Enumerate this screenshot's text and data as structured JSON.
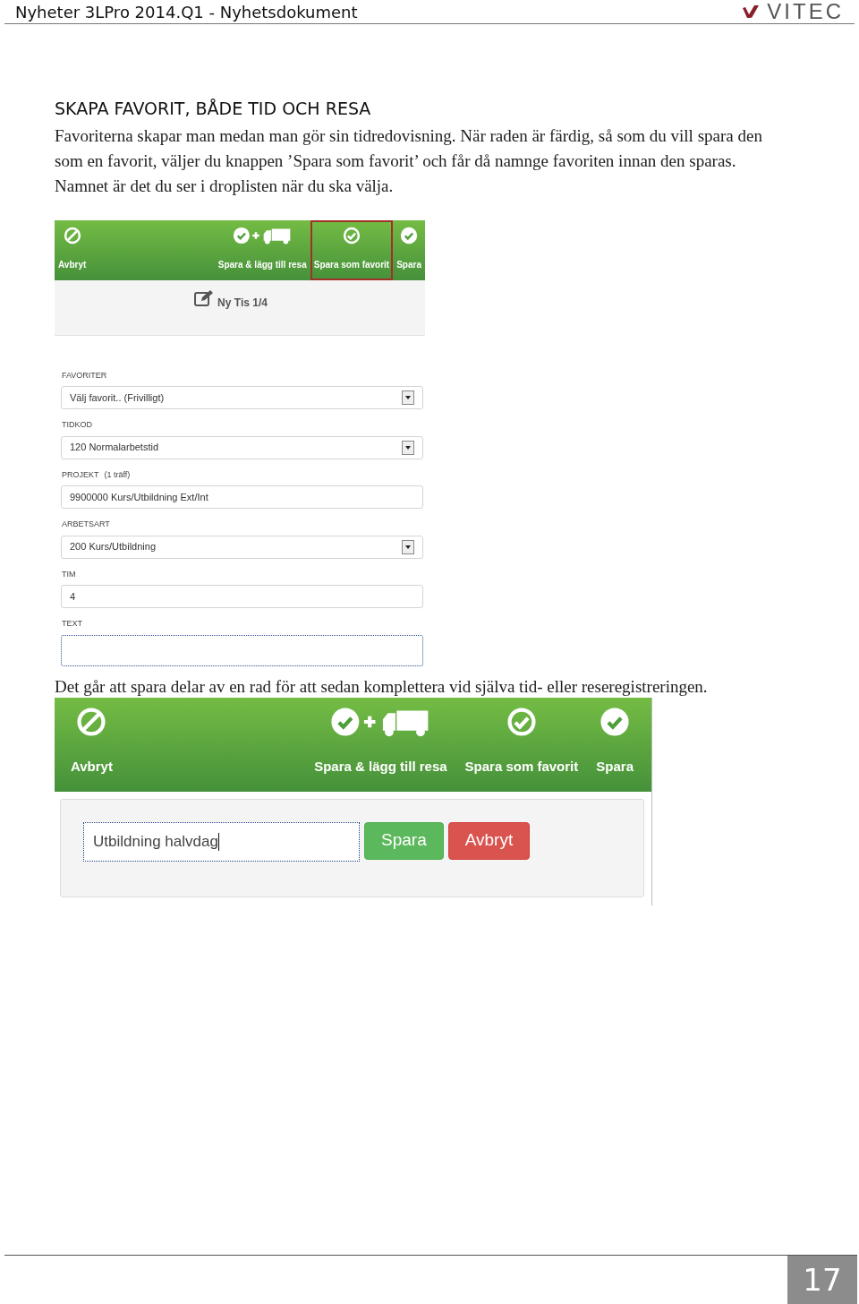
{
  "header": {
    "title": "Nyheter 3LPro 2014.Q1 - Nyhetsdokument",
    "logo_text": "VITEC"
  },
  "section_title": "SKAPA FAVORIT, BÅDE TID OCH RESA",
  "intro": "Favoriterna skapar man medan man gör sin tidredovisning. När raden är färdig, så som du vill spara den som en favorit, väljer du knappen ’Spara som favorit’ och får då namnge favoriten innan den sparas. Namnet är det du ser i droplisten när du ska välja.",
  "screenshot_1": {
    "toolbar": [
      {
        "kind": "cancel",
        "label": "Avbryt",
        "highlighted": false
      },
      {
        "kind": "save_trip",
        "label": "Spara & lägg till resa",
        "highlighted": false
      },
      {
        "kind": "save_favorite",
        "label": "Spara som favorit",
        "highlighted": true
      },
      {
        "kind": "save",
        "label": "Spara",
        "highlighted": false
      }
    ],
    "heading": "Ny Tis 1/4",
    "fields": [
      {
        "kind": "select",
        "label": "FAVORITER",
        "value": "Välj favorit.. (Frivilligt)",
        "focused": false
      },
      {
        "kind": "select",
        "label": "TIDKOD",
        "value": "120 Normalarbetstid",
        "focused": false
      },
      {
        "kind": "text",
        "label": "PROJEKT",
        "hint": "(1 träff)",
        "value": "9900000 Kurs/Utbildning Ext/Int",
        "focused": false
      },
      {
        "kind": "select",
        "label": "ARBETSART",
        "value": "200 Kurs/Utbildning",
        "focused": false
      },
      {
        "kind": "text",
        "label": "TIM",
        "value": "4",
        "focused": false
      },
      {
        "kind": "text",
        "label": "TEXT",
        "focused": true
      }
    ]
  },
  "note": "Det går att spara delar av en rad för att sedan komplettera vid själva tid- eller reseregistreringen.",
  "screenshot_2": {
    "toolbar": [
      {
        "kind": "cancel",
        "label": "Avbryt",
        "highlighted": false
      },
      {
        "kind": "save_trip",
        "label": "Spara & lägg till resa",
        "highlighted": false
      },
      {
        "kind": "save_favorite",
        "label": "Spara som favorit",
        "highlighted": false
      },
      {
        "kind": "save",
        "label": "Spara",
        "highlighted": false
      }
    ],
    "name_field": {
      "value": "Utbildning halvdag",
      "focused": true
    },
    "buttons": [
      {
        "kind": "save",
        "label": "Spara"
      },
      {
        "kind": "cancel",
        "label": "Avbryt"
      }
    ]
  },
  "page_number": "17"
}
